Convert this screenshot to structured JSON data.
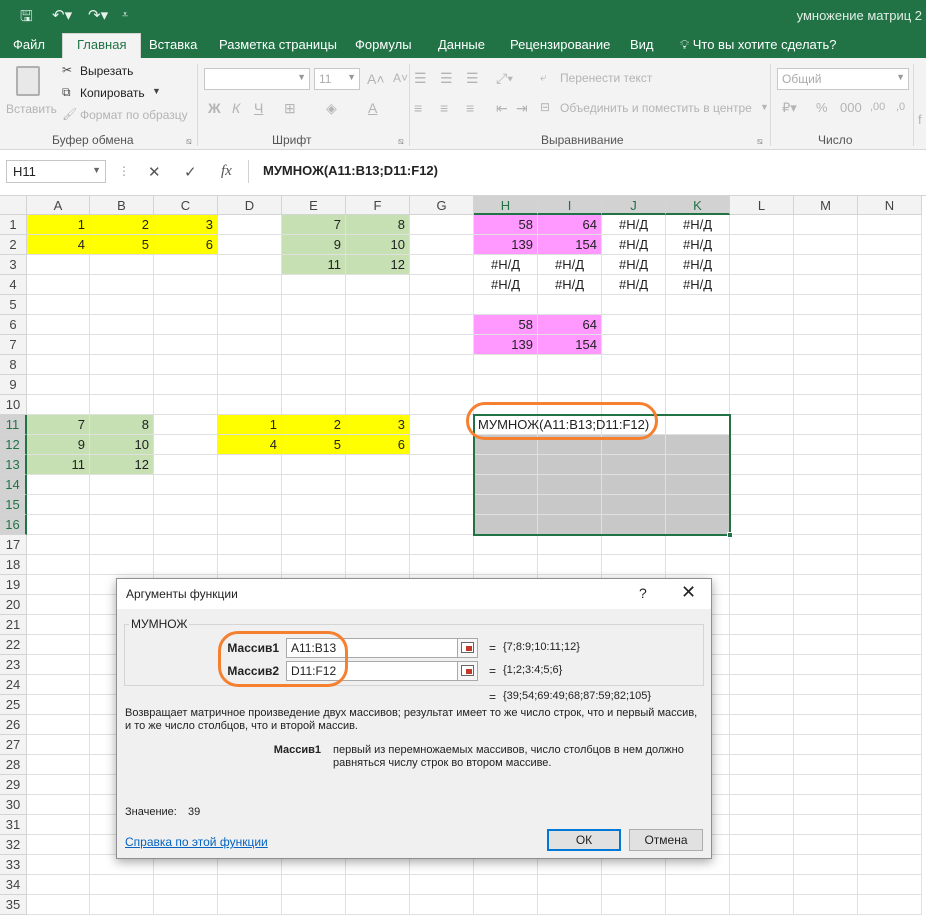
{
  "doc_title": "умножение матриц 2",
  "tabs": {
    "file": "Файл",
    "items": [
      "Главная",
      "Вставка",
      "Разметка страницы",
      "Формулы",
      "Данные",
      "Рецензирование",
      "Вид"
    ],
    "search": "Что вы хотите сделать?"
  },
  "ribbon": {
    "paste": "Вставить",
    "cut": "Вырезать",
    "copy": "Копировать",
    "format_painter": "Формат по образцу",
    "group_clipboard": "Буфер обмена",
    "font_size": "11",
    "bold": "Ж",
    "italic": "К",
    "underline": "Ч",
    "group_font": "Шрифт",
    "wrap_text": "Перенести текст",
    "merge_center": "Объединить и поместить в центре",
    "group_alignment": "Выравнивание",
    "number_format": "Общий",
    "group_number": "Число"
  },
  "formula_bar": {
    "name_box": "H11",
    "fx": "fx",
    "formula": "МУМНОЖ(A11:B13;D11:F12)"
  },
  "grid": {
    "columns": [
      "A",
      "B",
      "C",
      "D",
      "E",
      "F",
      "G",
      "H",
      "I",
      "J",
      "K",
      "L",
      "M",
      "N"
    ],
    "rows": [
      "1",
      "2",
      "3",
      "4",
      "5",
      "6",
      "7",
      "8",
      "9",
      "10",
      "11",
      "12",
      "13",
      "14",
      "15",
      "16",
      "17",
      "18",
      "19",
      "20",
      "21",
      "22",
      "23",
      "24",
      "25",
      "26",
      "27",
      "28",
      "29",
      "30",
      "31",
      "32",
      "33",
      "34",
      "35"
    ],
    "cells": [
      {
        "ref": "A1",
        "v": "1",
        "fill": "#ffff00"
      },
      {
        "ref": "B1",
        "v": "2",
        "fill": "#ffff00"
      },
      {
        "ref": "C1",
        "v": "3",
        "fill": "#ffff00"
      },
      {
        "ref": "A2",
        "v": "4",
        "fill": "#ffff00"
      },
      {
        "ref": "B2",
        "v": "5",
        "fill": "#ffff00"
      },
      {
        "ref": "C2",
        "v": "6",
        "fill": "#ffff00"
      },
      {
        "ref": "E1",
        "v": "7",
        "fill": "#c6e0b4"
      },
      {
        "ref": "F1",
        "v": "8",
        "fill": "#c6e0b4"
      },
      {
        "ref": "E2",
        "v": "9",
        "fill": "#c6e0b4"
      },
      {
        "ref": "F2",
        "v": "10",
        "fill": "#c6e0b4"
      },
      {
        "ref": "E3",
        "v": "11",
        "fill": "#c6e0b4"
      },
      {
        "ref": "F3",
        "v": "12",
        "fill": "#c6e0b4"
      },
      {
        "ref": "H1",
        "v": "58",
        "fill": "#ff99ff"
      },
      {
        "ref": "I1",
        "v": "64",
        "fill": "#ff99ff"
      },
      {
        "ref": "J1",
        "v": "#Н/Д",
        "align": "center"
      },
      {
        "ref": "K1",
        "v": "#Н/Д",
        "align": "center"
      },
      {
        "ref": "H2",
        "v": "139",
        "fill": "#ff99ff"
      },
      {
        "ref": "I2",
        "v": "154",
        "fill": "#ff99ff"
      },
      {
        "ref": "J2",
        "v": "#Н/Д",
        "align": "center"
      },
      {
        "ref": "K2",
        "v": "#Н/Д",
        "align": "center"
      },
      {
        "ref": "H3",
        "v": "#Н/Д",
        "align": "center"
      },
      {
        "ref": "I3",
        "v": "#Н/Д",
        "align": "center"
      },
      {
        "ref": "J3",
        "v": "#Н/Д",
        "align": "center"
      },
      {
        "ref": "K3",
        "v": "#Н/Д",
        "align": "center"
      },
      {
        "ref": "H4",
        "v": "#Н/Д",
        "align": "center"
      },
      {
        "ref": "I4",
        "v": "#Н/Д",
        "align": "center"
      },
      {
        "ref": "J4",
        "v": "#Н/Д",
        "align": "center"
      },
      {
        "ref": "K4",
        "v": "#Н/Д",
        "align": "center"
      },
      {
        "ref": "H6",
        "v": "58",
        "fill": "#ff99ff"
      },
      {
        "ref": "I6",
        "v": "64",
        "fill": "#ff99ff"
      },
      {
        "ref": "H7",
        "v": "139",
        "fill": "#ff99ff"
      },
      {
        "ref": "I7",
        "v": "154",
        "fill": "#ff99ff"
      },
      {
        "ref": "A11",
        "v": "7",
        "fill": "#c6e0b4"
      },
      {
        "ref": "B11",
        "v": "8",
        "fill": "#c6e0b4"
      },
      {
        "ref": "A12",
        "v": "9",
        "fill": "#c6e0b4"
      },
      {
        "ref": "B12",
        "v": "10",
        "fill": "#c6e0b4"
      },
      {
        "ref": "A13",
        "v": "11",
        "fill": "#c6e0b4"
      },
      {
        "ref": "B13",
        "v": "12",
        "fill": "#c6e0b4"
      },
      {
        "ref": "D11",
        "v": "1",
        "fill": "#ffff00"
      },
      {
        "ref": "E11",
        "v": "2",
        "fill": "#ffff00"
      },
      {
        "ref": "F11",
        "v": "3",
        "fill": "#ffff00"
      },
      {
        "ref": "D12",
        "v": "4",
        "fill": "#ffff00"
      },
      {
        "ref": "E12",
        "v": "5",
        "fill": "#ffff00"
      },
      {
        "ref": "F12",
        "v": "6",
        "fill": "#ffff00"
      },
      {
        "ref": "I11",
        "v": "",
        "fill": "#ffffff"
      },
      {
        "ref": "J11",
        "v": "",
        "fill": "#ffffff"
      },
      {
        "ref": "K11",
        "v": "",
        "fill": "#ffffff"
      },
      {
        "ref": "H12",
        "v": "",
        "fill": "#c8c8c8"
      },
      {
        "ref": "I12",
        "v": "",
        "fill": "#c8c8c8"
      },
      {
        "ref": "J12",
        "v": "",
        "fill": "#c8c8c8"
      },
      {
        "ref": "K12",
        "v": "",
        "fill": "#c8c8c8"
      },
      {
        "ref": "H13",
        "v": "",
        "fill": "#c8c8c8"
      },
      {
        "ref": "I13",
        "v": "",
        "fill": "#c8c8c8"
      },
      {
        "ref": "J13",
        "v": "",
        "fill": "#c8c8c8"
      },
      {
        "ref": "K13",
        "v": "",
        "fill": "#c8c8c8"
      },
      {
        "ref": "H14",
        "v": "",
        "fill": "#c8c8c8"
      },
      {
        "ref": "I14",
        "v": "",
        "fill": "#c8c8c8"
      },
      {
        "ref": "J14",
        "v": "",
        "fill": "#c8c8c8"
      },
      {
        "ref": "K14",
        "v": "",
        "fill": "#c8c8c8"
      },
      {
        "ref": "H15",
        "v": "",
        "fill": "#c8c8c8"
      },
      {
        "ref": "I15",
        "v": "",
        "fill": "#c8c8c8"
      },
      {
        "ref": "J15",
        "v": "",
        "fill": "#c8c8c8"
      },
      {
        "ref": "K15",
        "v": "",
        "fill": "#c8c8c8"
      },
      {
        "ref": "H16",
        "v": "",
        "fill": "#c8c8c8"
      },
      {
        "ref": "I16",
        "v": "",
        "fill": "#c8c8c8"
      },
      {
        "ref": "J16",
        "v": "",
        "fill": "#c8c8c8"
      },
      {
        "ref": "K16",
        "v": "",
        "fill": "#c8c8c8"
      }
    ],
    "editing_cell": {
      "ref": "H11",
      "text": "МУМНОЖ(A11:B13;D11:F12)"
    },
    "selection": "H11:K16"
  },
  "dialog": {
    "title": "Аргументы функции",
    "help": "?",
    "close": "✕",
    "function_name": "МУМНОЖ",
    "args": [
      {
        "label": "Массив1",
        "value": "A11:B13",
        "result": "{7;8:9;10:11;12}"
      },
      {
        "label": "Массив2",
        "value": "D11:F12",
        "result": "{1;2;3:4;5;6}"
      }
    ],
    "total_result": "{39;54;69:49;68;87:59;82;105}",
    "description": "Возвращает матричное произведение двух массивов; результат имеет то же число строк, что и первый массив, и то же число столбцов, что и второй массив.",
    "arg_help_name": "Массив1",
    "arg_help_text": "первый из перемножаемых массивов, число столбцов в нем должно равняться числу строк во втором массиве.",
    "value_label": "Значение:",
    "value": "39",
    "help_link": "Справка по этой функции",
    "ok": "ОК",
    "cancel": "Отмена"
  }
}
